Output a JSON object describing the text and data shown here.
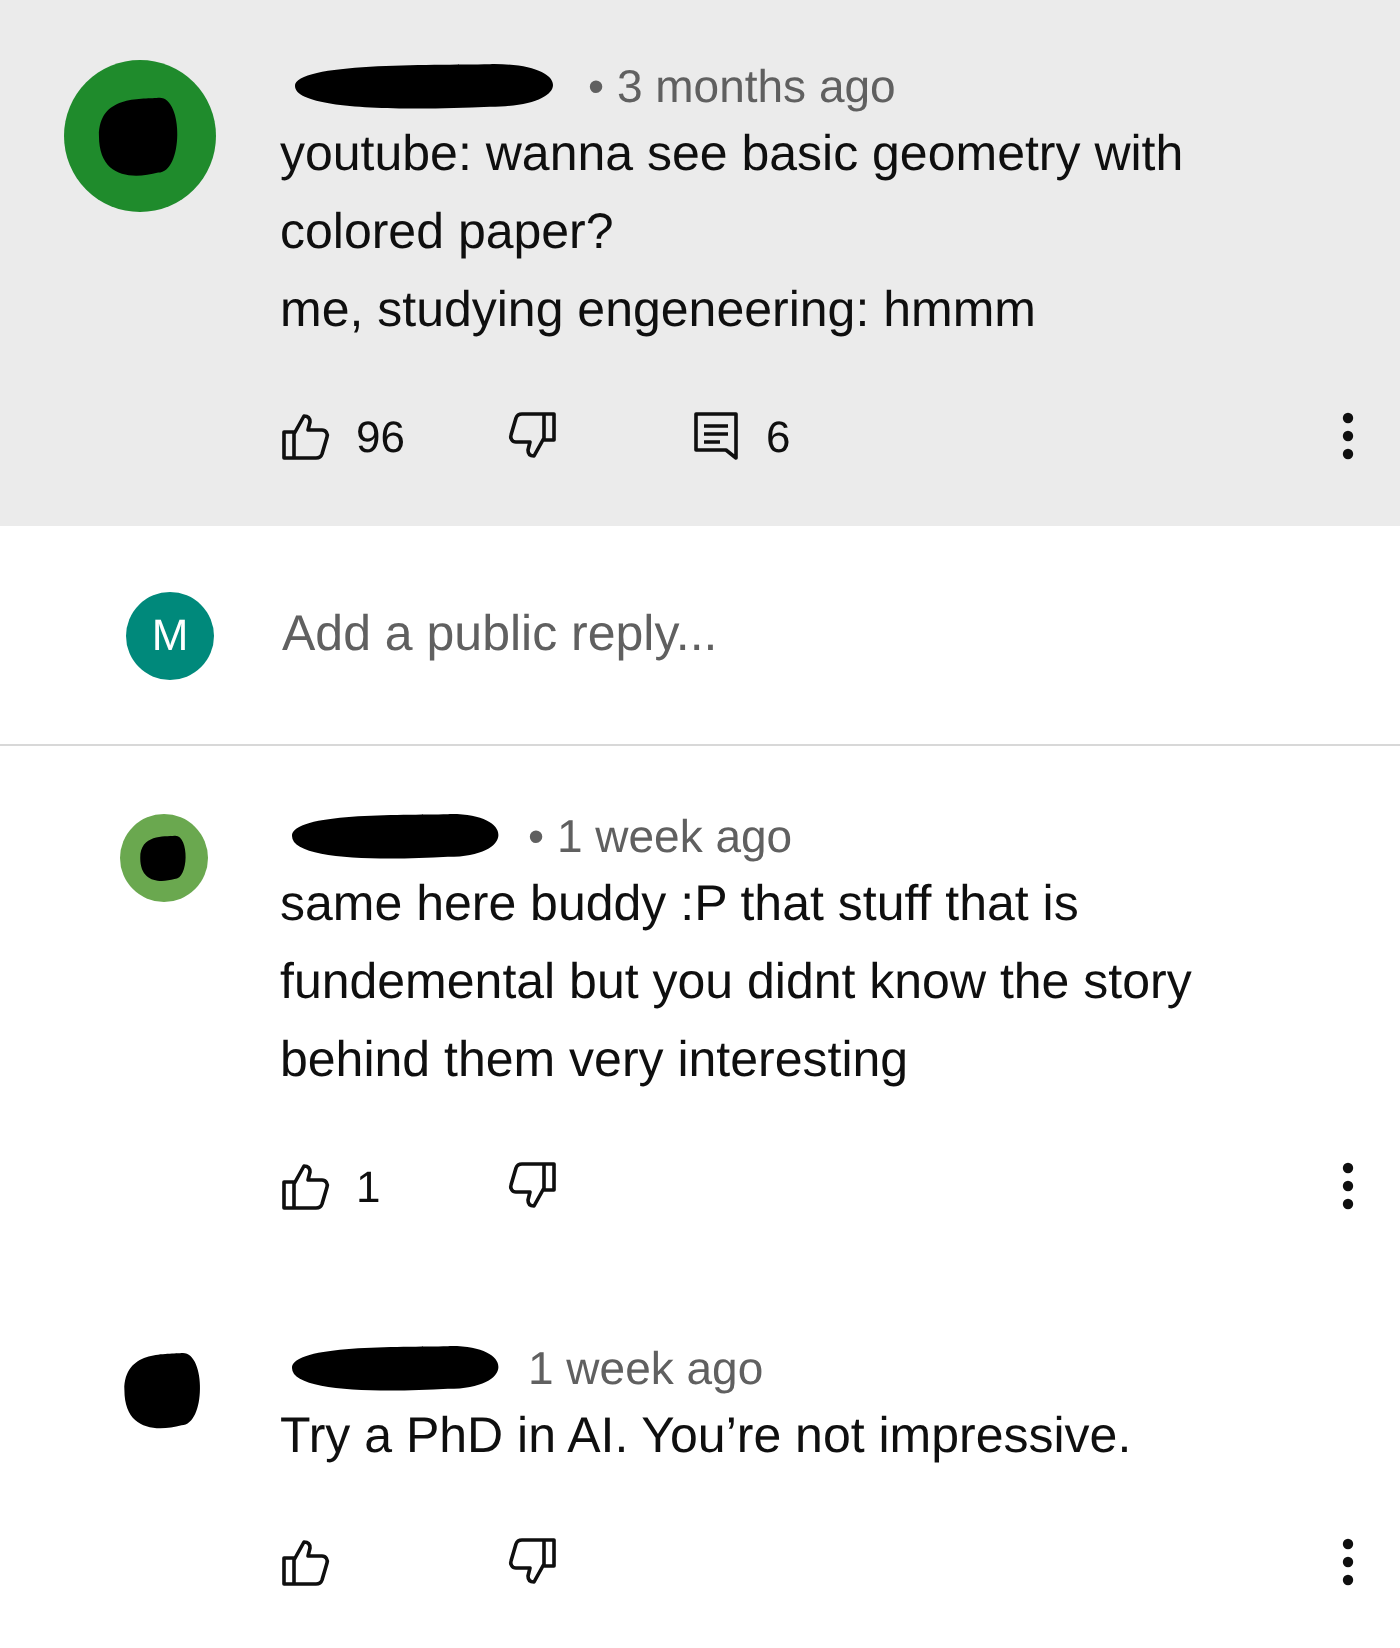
{
  "comments": [
    {
      "kind": "comment",
      "highlighted": true,
      "color": "#1f8b2c",
      "time": "• 3 months ago",
      "lines": [
        "youtube: wanna see basic geometry with colored paper?",
        "me, studying engeneering: hmmm"
      ],
      "likes": "96",
      "replies": "6"
    },
    {
      "kind": "reply_box",
      "color": "#00897b",
      "avatar_letter": "M",
      "placeholder": "Add a public reply..."
    },
    {
      "kind": "reply",
      "highlighted": false,
      "color": "#6aa84f",
      "time": "• 1 week ago",
      "lines": [
        "same here buddy :P that stuff that is fundemental but you didnt know the story behind them very interesting"
      ],
      "likes": "1"
    },
    {
      "kind": "reply",
      "highlighted": false,
      "color": "#000000",
      "time": "1 week ago",
      "lines": [
        "Try a PhD in AI. You’re not impressive."
      ]
    }
  ]
}
